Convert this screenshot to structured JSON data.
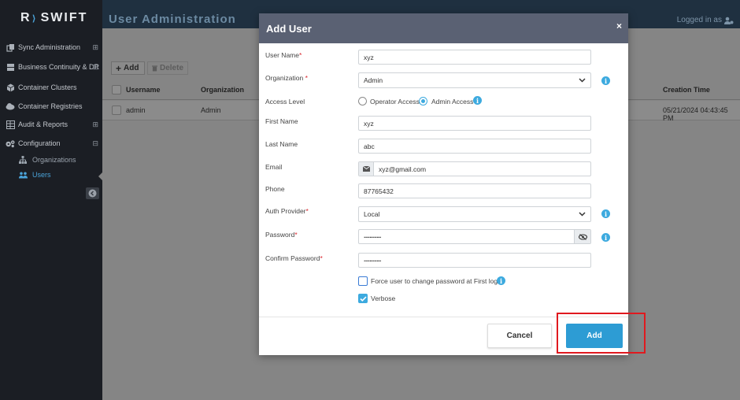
{
  "app": {
    "logo_text": "SWIFT",
    "logo_letter": "R",
    "page_title": "User Administration",
    "logged_in_text": "Logged in as"
  },
  "sidebar": {
    "items": [
      {
        "label": "Sync Administration",
        "expand": "⊞"
      },
      {
        "label": "Business Continuity & DR",
        "expand": "⊞"
      },
      {
        "label": "Container Clusters",
        "expand": ""
      },
      {
        "label": "Container Registries",
        "expand": ""
      },
      {
        "label": "Audit & Reports",
        "expand": "⊞"
      },
      {
        "label": "Configuration",
        "expand": "⊟"
      }
    ],
    "sub_items": [
      {
        "label": "Organizations"
      },
      {
        "label": "Users"
      }
    ]
  },
  "toolbar": {
    "add_label": "Add",
    "delete_label": "Delete"
  },
  "grid": {
    "columns": [
      "Username",
      "Organization",
      "Creation Time"
    ],
    "rows": [
      {
        "username": "admin",
        "organization": "Admin",
        "creation_time": "05/21/2024 04:43:45 PM"
      }
    ]
  },
  "modal": {
    "title": "Add User",
    "close_glyph": "×",
    "fields": {
      "user_name": {
        "label": "User Name",
        "value": "xyz"
      },
      "organization": {
        "label": "Organization",
        "value": "Admin"
      },
      "access_level": {
        "label": "Access Level",
        "option_operator": "Operator Access",
        "option_admin": "Admin Access",
        "selected": "Admin Access"
      },
      "first_name": {
        "label": "First Name",
        "value": "xyz"
      },
      "last_name": {
        "label": "Last Name",
        "value": "abc"
      },
      "email": {
        "label": "Email",
        "value": "xyz@gmail.com"
      },
      "phone": {
        "label": "Phone",
        "value": "87765432"
      },
      "auth_provider": {
        "label": "Auth Provider",
        "value": "Local"
      },
      "password": {
        "label": "Password",
        "value": "············"
      },
      "confirm_password": {
        "label": "Confirm Password",
        "value": "············"
      }
    },
    "force_change": {
      "label": "Force user to change password at First login",
      "checked": false
    },
    "verbose": {
      "label": "Verbose",
      "checked": true
    },
    "cancel_label": "Cancel",
    "add_label": "Add"
  },
  "colors": {
    "accent": "#2d9cd4",
    "highlight": "#e0191f",
    "modal_header": "#5a6173",
    "sidebar": "#1b1e24"
  }
}
